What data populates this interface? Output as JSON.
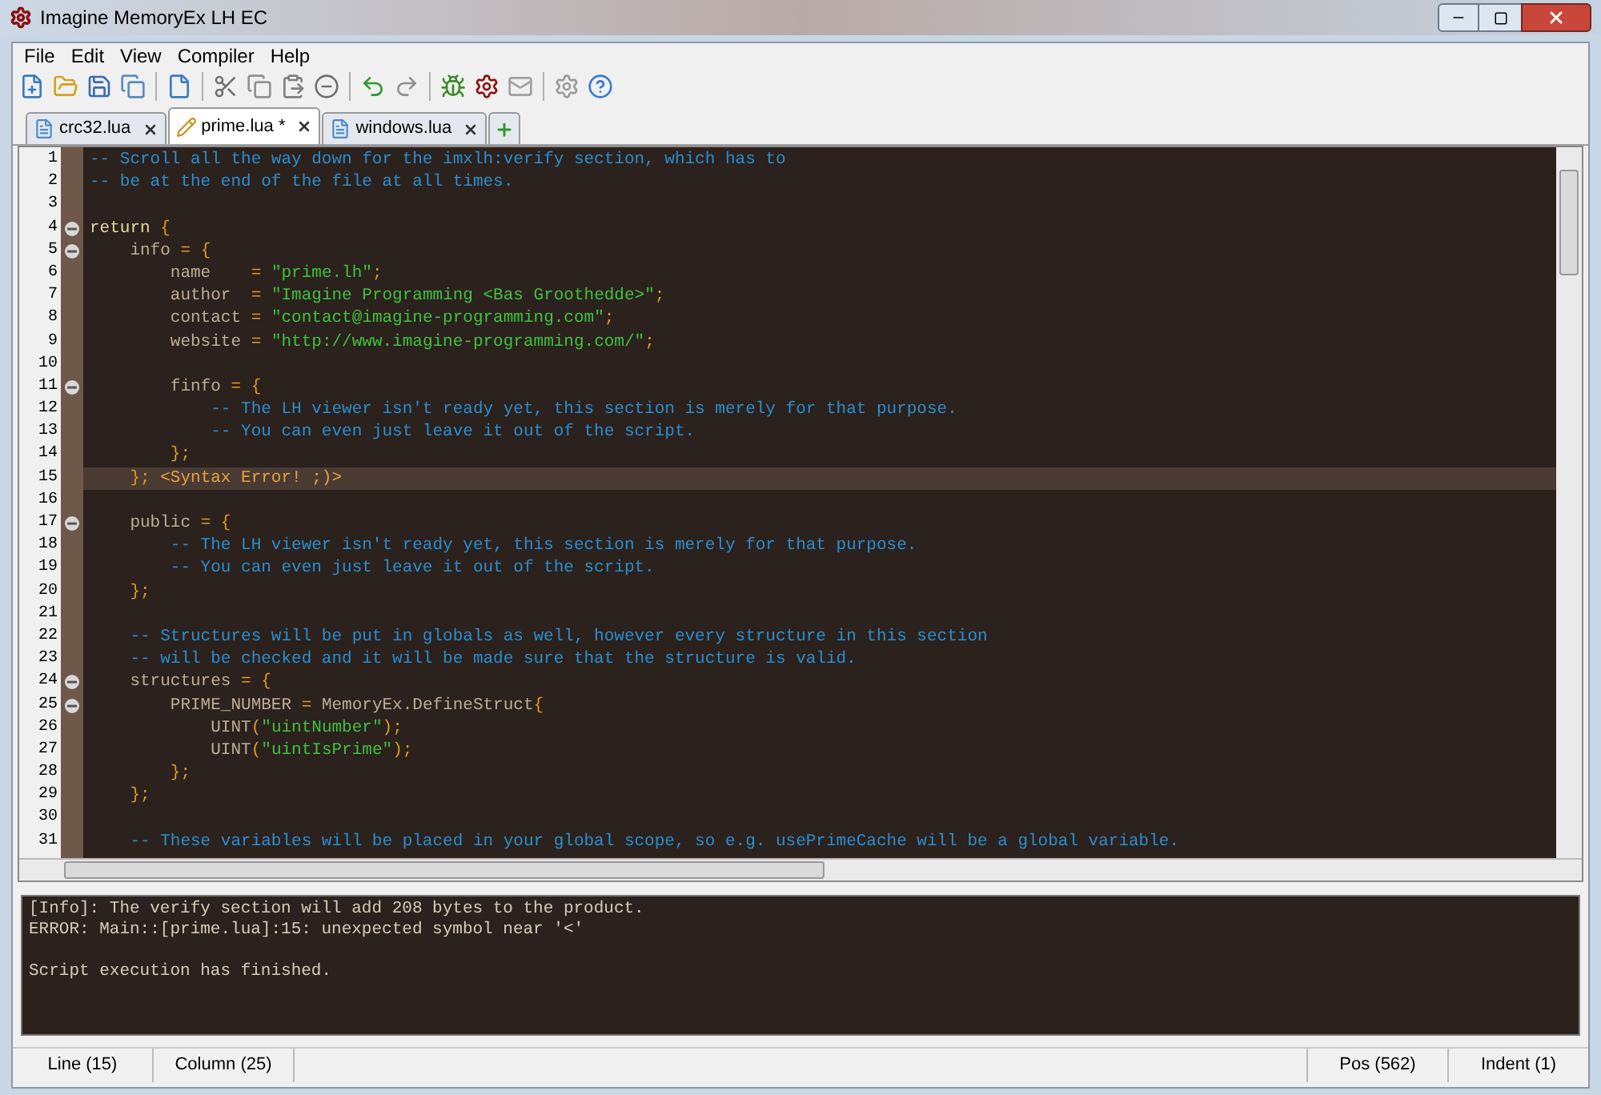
{
  "window": {
    "title": "Imagine MemoryEx LH EC"
  },
  "menu": [
    "File",
    "Edit",
    "View",
    "Compiler",
    "Help"
  ],
  "tabs": [
    {
      "label": "crc32.lua",
      "selected": false,
      "modified": false
    },
    {
      "label": "prime.lua *",
      "selected": true,
      "modified": true
    },
    {
      "label": "windows.lua",
      "selected": false,
      "modified": false
    }
  ],
  "editor": {
    "lines": [
      {
        "number": "1",
        "tokens": [
          {
            "kind": "comment",
            "text": "-- Scroll all the way down for the imxlh:verify section, which has to"
          }
        ]
      },
      {
        "number": "2",
        "tokens": [
          {
            "kind": "comment",
            "text": "-- be at the end of the file at all times."
          }
        ]
      },
      {
        "number": "3"
      },
      {
        "number": "4",
        "fold": true,
        "tokens": [
          {
            "kind": "keyword",
            "text": "return"
          },
          {
            "kind": "symbol",
            "text": " {"
          }
        ]
      },
      {
        "number": "5",
        "fold": true,
        "tokens": [
          {
            "kind": "name",
            "text": "    info"
          },
          {
            "kind": "symbol",
            "text": " = {"
          }
        ]
      },
      {
        "number": "6",
        "tokens": [
          {
            "kind": "name",
            "text": "        name    "
          },
          {
            "kind": "symbol",
            "text": "= "
          },
          {
            "kind": "string",
            "text": "\"prime.lh\""
          },
          {
            "kind": "symbol",
            "text": ";"
          }
        ]
      },
      {
        "number": "7",
        "tokens": [
          {
            "kind": "name",
            "text": "        author  "
          },
          {
            "kind": "symbol",
            "text": "= "
          },
          {
            "kind": "string",
            "text": "\"Imagine Programming <Bas Groothedde>\""
          },
          {
            "kind": "symbol",
            "text": ";"
          }
        ]
      },
      {
        "number": "8",
        "tokens": [
          {
            "kind": "name",
            "text": "        contact "
          },
          {
            "kind": "symbol",
            "text": "= "
          },
          {
            "kind": "string",
            "text": "\"contact@imagine-programming.com\""
          },
          {
            "kind": "symbol",
            "text": ";"
          }
        ]
      },
      {
        "number": "9",
        "tokens": [
          {
            "kind": "name",
            "text": "        website "
          },
          {
            "kind": "symbol",
            "text": "= "
          },
          {
            "kind": "string",
            "text": "\"http://www.imagine-programming.com/\""
          },
          {
            "kind": "symbol",
            "text": ";"
          }
        ]
      },
      {
        "number": "10"
      },
      {
        "number": "11",
        "fold": true,
        "tokens": [
          {
            "kind": "name",
            "text": "        finfo "
          },
          {
            "kind": "symbol",
            "text": "= {"
          }
        ]
      },
      {
        "number": "12",
        "tokens": [
          {
            "kind": "comment",
            "text": "            -- The LH viewer isn't ready yet, this section is merely for that purpose."
          }
        ]
      },
      {
        "number": "13",
        "tokens": [
          {
            "kind": "comment",
            "text": "            -- You can even just leave it out of the script."
          }
        ]
      },
      {
        "number": "14",
        "tokens": [
          {
            "kind": "symbol",
            "text": "        };"
          }
        ]
      },
      {
        "number": "15",
        "current": true,
        "tokens": [
          {
            "kind": "symbol",
            "text": "    }; "
          },
          {
            "kind": "error",
            "text": "<Syntax Error! ;)>"
          }
        ]
      },
      {
        "number": "16"
      },
      {
        "number": "17",
        "fold": true,
        "tokens": [
          {
            "kind": "name",
            "text": "    public "
          },
          {
            "kind": "symbol",
            "text": "= {"
          }
        ]
      },
      {
        "number": "18",
        "tokens": [
          {
            "kind": "comment",
            "text": "        -- The LH viewer isn't ready yet, this section is merely for that purpose."
          }
        ]
      },
      {
        "number": "19",
        "tokens": [
          {
            "kind": "comment",
            "text": "        -- You can even just leave it out of the script."
          }
        ]
      },
      {
        "number": "20",
        "tokens": [
          {
            "kind": "symbol",
            "text": "    };"
          }
        ]
      },
      {
        "number": "21"
      },
      {
        "number": "22",
        "tokens": [
          {
            "kind": "comment",
            "text": "    -- Structures will be put in globals as well, however every structure in this section"
          }
        ]
      },
      {
        "number": "23",
        "tokens": [
          {
            "kind": "comment",
            "text": "    -- will be checked and it will be made sure that the structure is valid."
          }
        ]
      },
      {
        "number": "24",
        "fold": true,
        "tokens": [
          {
            "kind": "name",
            "text": "    structures "
          },
          {
            "kind": "symbol",
            "text": "= {"
          }
        ]
      },
      {
        "number": "25",
        "fold": true,
        "tokens": [
          {
            "kind": "name",
            "text": "        PRIME_NUMBER "
          },
          {
            "kind": "symbol",
            "text": "= "
          },
          {
            "kind": "name",
            "text": "MemoryEx.DefineStruct"
          },
          {
            "kind": "symbol",
            "text": "{"
          }
        ]
      },
      {
        "number": "26",
        "tokens": [
          {
            "kind": "name",
            "text": "            UINT"
          },
          {
            "kind": "symbol",
            "text": "("
          },
          {
            "kind": "string",
            "text": "\"uintNumber\""
          },
          {
            "kind": "symbol",
            "text": ");"
          }
        ]
      },
      {
        "number": "27",
        "tokens": [
          {
            "kind": "name",
            "text": "            UINT"
          },
          {
            "kind": "symbol",
            "text": "("
          },
          {
            "kind": "string",
            "text": "\"uintIsPrime\""
          },
          {
            "kind": "symbol",
            "text": ");"
          }
        ]
      },
      {
        "number": "28",
        "tokens": [
          {
            "kind": "symbol",
            "text": "        };"
          }
        ]
      },
      {
        "number": "29",
        "tokens": [
          {
            "kind": "symbol",
            "text": "    };"
          }
        ]
      },
      {
        "number": "30"
      },
      {
        "number": "31",
        "tokens": [
          {
            "kind": "comment",
            "text": "    -- These variables will be placed in your global scope, so e.g. usePrimeCache will be a global variable."
          }
        ]
      }
    ]
  },
  "output": [
    {
      "text": "[Info]: The verify section will add 208 bytes to the product.",
      "gap_before": false
    },
    {
      "text": "ERROR: Main::[prime.lua]:15: unexpected symbol near '<'",
      "gap_before": false
    },
    {
      "text": "Script execution has finished.",
      "gap_before": true
    }
  ],
  "status_bar": {
    "left": [
      "Line (15)",
      "Column (25)"
    ],
    "right": [
      "Pos (562)",
      "Indent (1)"
    ]
  }
}
